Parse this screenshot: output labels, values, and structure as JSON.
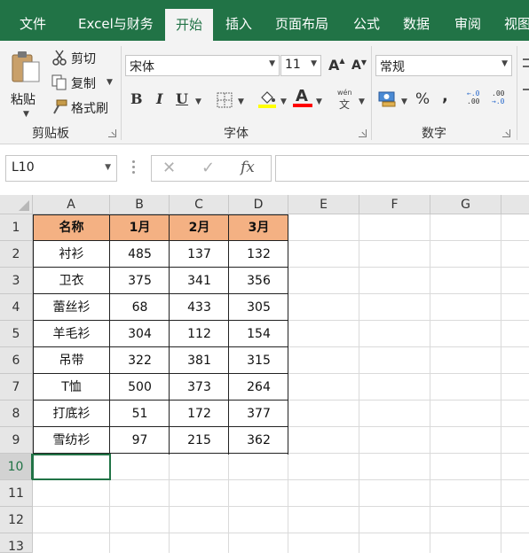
{
  "tabs": [
    "文件",
    "Excel与财务",
    "开始",
    "插入",
    "页面布局",
    "公式",
    "数据",
    "审阅",
    "视图"
  ],
  "active_tab": "开始",
  "ribbon": {
    "clipboard": {
      "paste": "粘贴",
      "cut": "剪切",
      "copy": "复制",
      "format_painter": "格式刷",
      "group_label": "剪贴板"
    },
    "font": {
      "font_name": "宋体",
      "font_size": "11",
      "bold": "B",
      "italic": "I",
      "underline": "U",
      "phonetic": "wén",
      "group_label": "字体"
    },
    "number": {
      "format": "常规",
      "percent": "%",
      "comma": ",",
      "group_label": "数字"
    }
  },
  "formula_bar": {
    "name_box": "L10",
    "fx": "fx",
    "formula": ""
  },
  "columns": [
    "A",
    "B",
    "C",
    "D",
    "E",
    "F",
    "G"
  ],
  "rows": [
    "1",
    "2",
    "3",
    "4",
    "5",
    "6",
    "7",
    "8",
    "9",
    "10",
    "11",
    "12",
    "13"
  ],
  "selected_cell": "A10",
  "table": {
    "headers": [
      "名称",
      "1月",
      "2月",
      "3月"
    ],
    "rows": [
      [
        "衬衫",
        "485",
        "137",
        "132"
      ],
      [
        "卫衣",
        "375",
        "341",
        "356"
      ],
      [
        "蕾丝衫",
        "68",
        "433",
        "305"
      ],
      [
        "羊毛衫",
        "304",
        "112",
        "154"
      ],
      [
        "吊带",
        "322",
        "381",
        "315"
      ],
      [
        "T恤",
        "500",
        "373",
        "264"
      ],
      [
        "打底衫",
        "51",
        "172",
        "377"
      ],
      [
        "雪纺衫",
        "97",
        "215",
        "362"
      ]
    ]
  },
  "colors": {
    "ribbon_green": "#217346",
    "header_fill": "#f4b183"
  }
}
